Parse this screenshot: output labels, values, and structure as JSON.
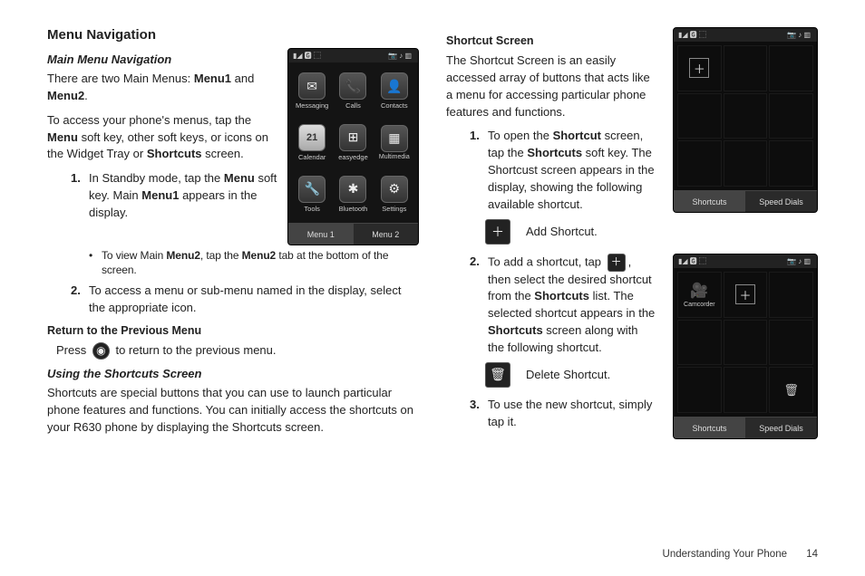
{
  "left": {
    "h2": "Menu Navigation",
    "h3_main": "Main Menu Navigation",
    "p_twomenus_a": "There are two Main Menus: ",
    "p_twomenus_b1": "Menu1",
    "p_twomenus_mid": " and ",
    "p_twomenus_b2": "Menu2",
    "p_twomenus_end": ".",
    "p_access_a": "To access your phone's menus, tap the ",
    "p_access_b": "Menu",
    "p_access_c": " soft key, other soft keys, or icons on the Widget Tray or ",
    "p_access_d": "Shortcuts",
    "p_access_e": " screen.",
    "step1_a": "In Standby mode, tap the ",
    "step1_b": "Menu",
    "step1_c": " soft key. Main ",
    "step1_d": "Menu1",
    "step1_e": " appears in the display.",
    "sub_a": "To view Main ",
    "sub_b": "Menu2",
    "sub_c": ", tap the ",
    "sub_d": "Menu2",
    "sub_e": " tab at the bottom of the screen.",
    "step2": "To access a menu or sub-menu named in the display, select the appropriate icon.",
    "h4_return": "Return to the Previous Menu",
    "return_a": "Press ",
    "return_b": " to return to the previous menu.",
    "h3_shortcuts": "Using the Shortcuts Screen",
    "p_shortcuts": "Shortcuts are special buttons that you can use to launch particular phone features and functions. You can initially access the shortcuts on your R630 phone by displaying the Shortcuts screen."
  },
  "right": {
    "h4_sc": "Shortcut Screen",
    "p_sc": "The Shortcut Screen is an easily accessed array of buttons that acts like a menu for accessing particular phone features and functions.",
    "s1_a": "To open the ",
    "s1_b": "Shortcut",
    "s1_c": " screen, tap the ",
    "s1_d": "Shortcuts",
    "s1_e": " soft key. The Shortcust screen appears in the display, showing the following available shortcut.",
    "add_label": "Add Shortcut.",
    "s2_a": "To add a shortcut, tap ",
    "s2_b": ", then select the desired shortcut from the ",
    "s2_c": "Shortcuts",
    "s2_d": " list. The selected shortcut appears in the ",
    "s2_e": "Shortcuts",
    "s2_f": " screen along with the following shortcut.",
    "del_label": "Delete Shortcut.",
    "s3": "To use the new shortcut, simply tap it."
  },
  "phone_menu": {
    "apps": [
      "Messaging",
      "Calls",
      "Contacts",
      "Calendar",
      "easyedge",
      "Multimedia",
      "Tools",
      "Bluetooth",
      "Settings"
    ],
    "tabs": [
      "Menu 1",
      "Menu 2"
    ]
  },
  "sc_phone": {
    "tabs": [
      "Shortcuts",
      "Speed Dials"
    ],
    "camcorder": "Camcorder"
  },
  "icons": {
    "plus": "＋",
    "trash": "🗑",
    "back": "◉",
    "signal": "▮◢",
    "misc1": "🅶 ⬚",
    "misc2": "📷 ♪ ▥",
    "msg": "✉",
    "call": "📞",
    "contact": "👤",
    "cal": "21",
    "edge": "⊞",
    "mm": "▦",
    "tools": "🔧",
    "bt": "✱",
    "gear": "⚙",
    "cam": "🎥"
  },
  "footer": {
    "section": "Understanding Your Phone",
    "page": "14"
  }
}
